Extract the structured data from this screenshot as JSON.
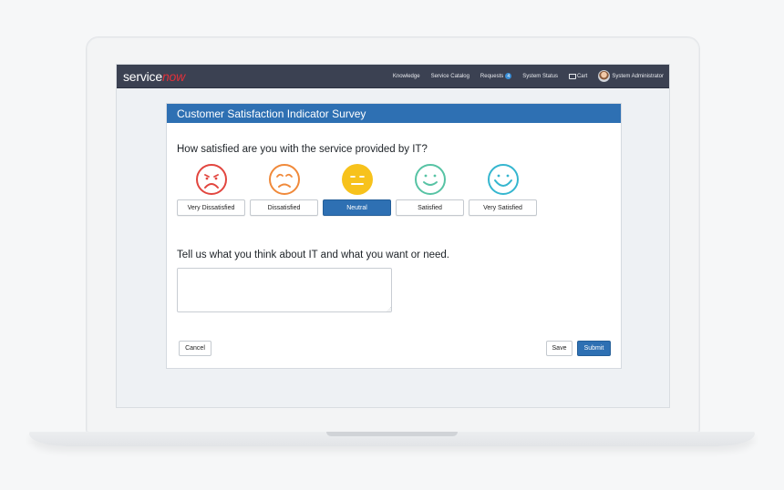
{
  "brand": {
    "part1": "service",
    "part2": "now"
  },
  "nav": {
    "knowledge": "Knowledge",
    "service_catalog": "Service Catalog",
    "requests": "Requests",
    "requests_count": "4",
    "system_status": "System Status",
    "cart": "Cart",
    "user": "System Administrator"
  },
  "survey": {
    "title": "Customer Satisfaction Indicator Survey",
    "question1": "How satisfied are you with the service provided by IT?",
    "options": [
      {
        "label": "Very Dissatisfied",
        "color": "#e2463f",
        "icon": "very-sad-face-icon"
      },
      {
        "label": "Dissatisfied",
        "color": "#f0893a",
        "icon": "sad-face-icon"
      },
      {
        "label": "Neutral",
        "color": "#f7c21c",
        "icon": "neutral-face-icon",
        "selected": true
      },
      {
        "label": "Satisfied",
        "color": "#57c3a4",
        "icon": "smile-face-icon"
      },
      {
        "label": "Very Satisfied",
        "color": "#35b6cf",
        "icon": "big-smile-face-icon"
      }
    ],
    "question2": "Tell us what you think about IT and what you want or need.",
    "feedback_value": "",
    "cancel_label": "Cancel",
    "save_label": "Save",
    "submit_label": "Submit"
  },
  "colors": {
    "navbar": "#3b4152",
    "accent": "#2e70b3",
    "logo_red": "#e0313a"
  }
}
